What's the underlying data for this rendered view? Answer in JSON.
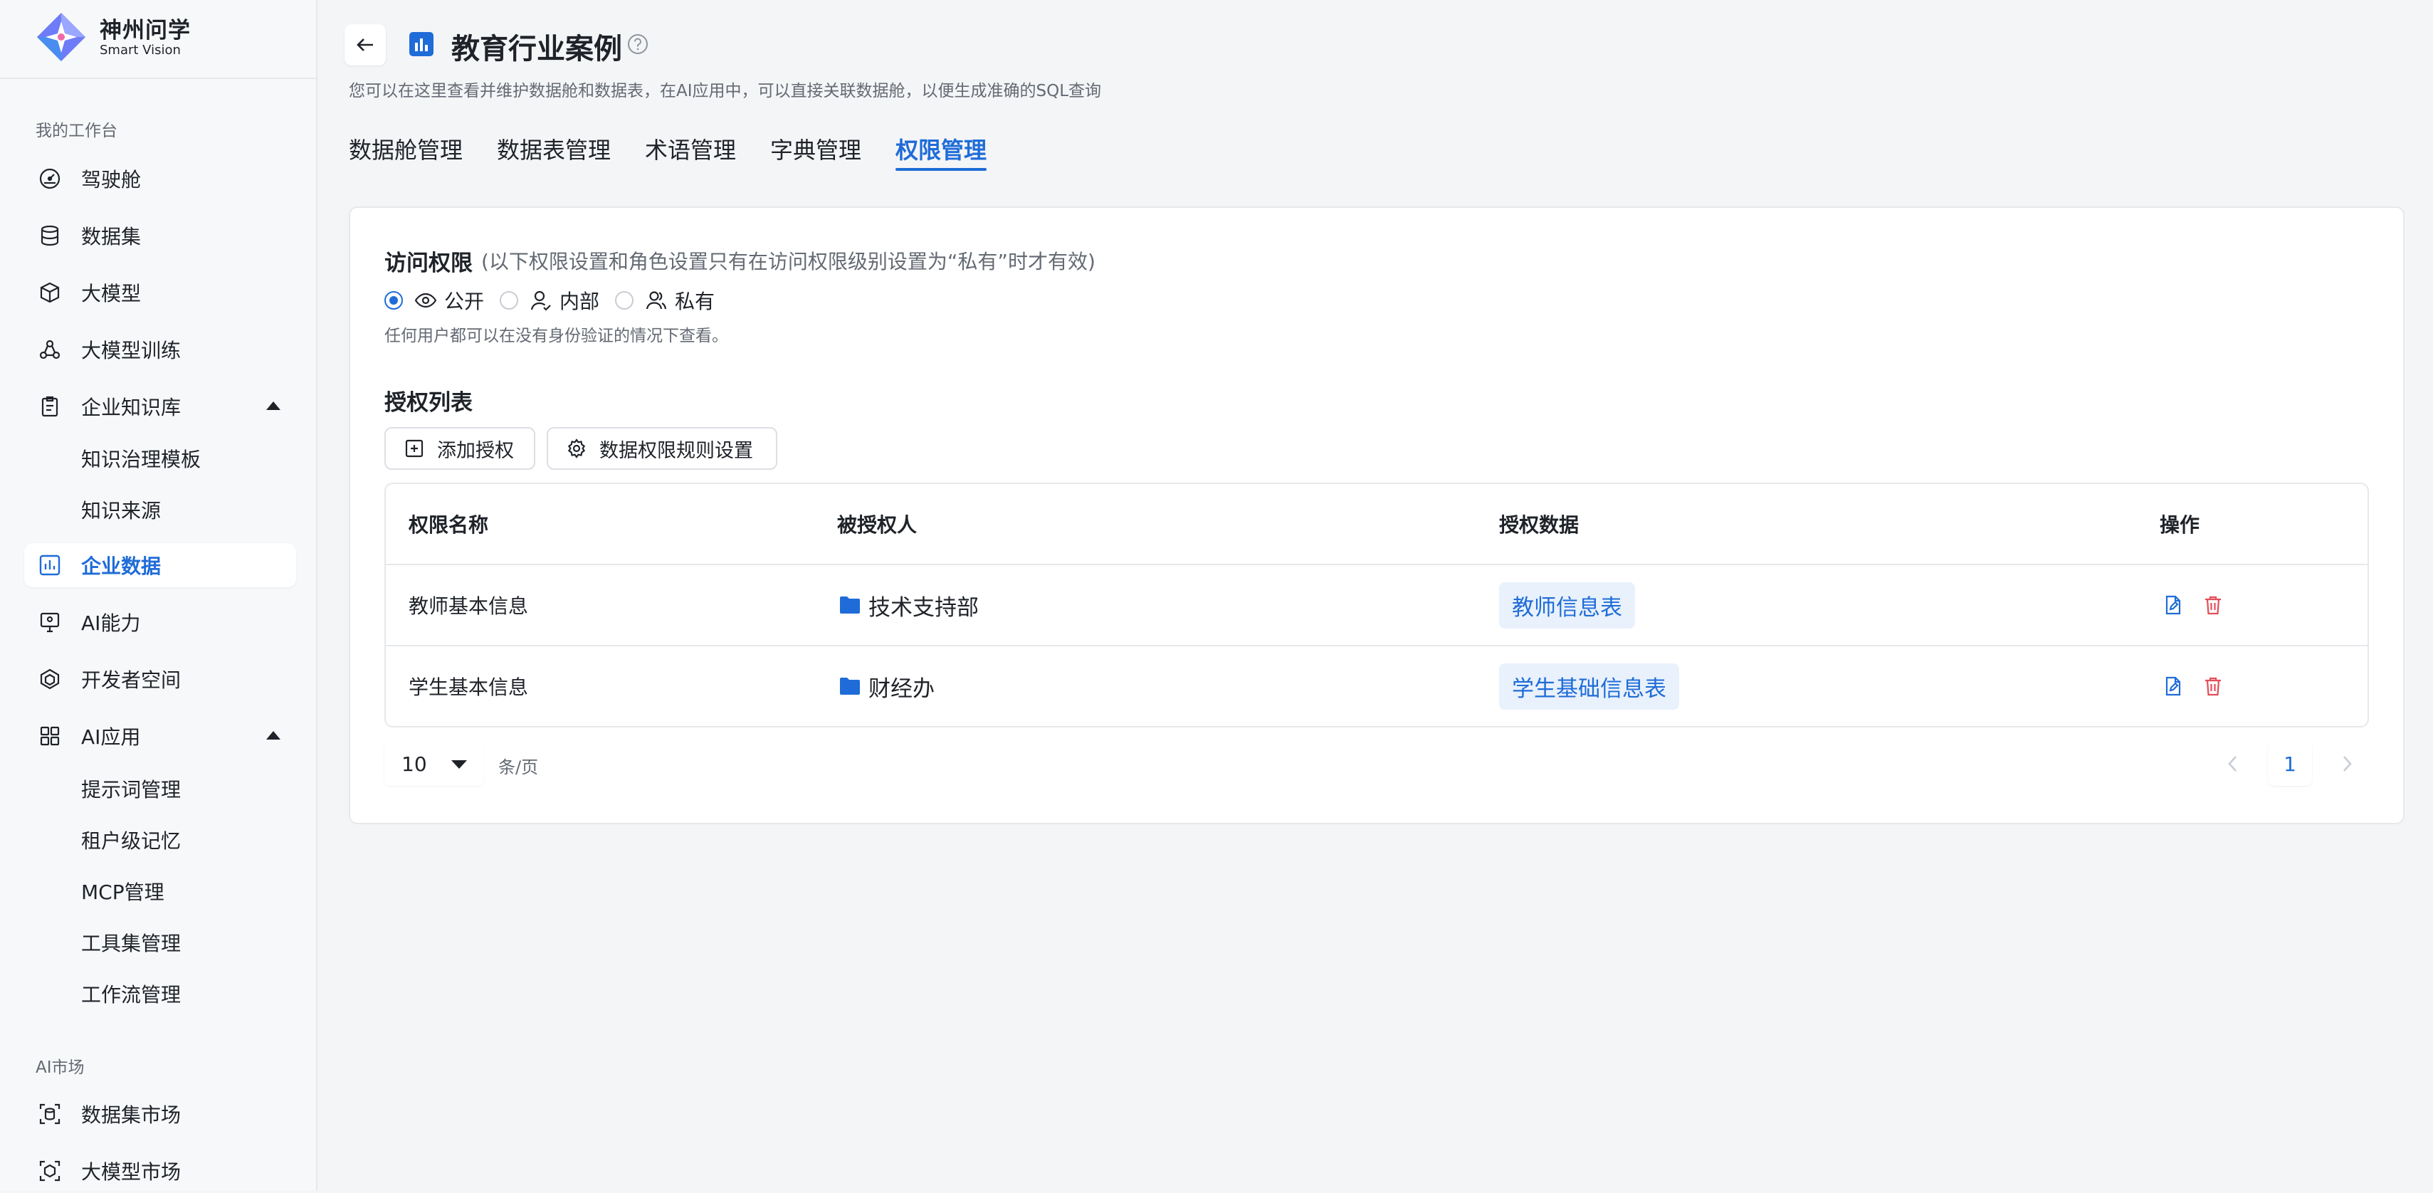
{
  "brand": {
    "name_cn": "神州问学",
    "name_en": "Smart Vision"
  },
  "sidebar": {
    "workbench_title": "我的工作台",
    "items": [
      {
        "label": "驾驶舱"
      },
      {
        "label": "数据集"
      },
      {
        "label": "大模型"
      },
      {
        "label": "大模型训练"
      },
      {
        "label": "企业知识库",
        "expanded": true,
        "children": [
          {
            "label": "知识治理模板"
          },
          {
            "label": "知识来源"
          }
        ]
      },
      {
        "label": "企业数据",
        "active": true
      },
      {
        "label": "AI能力"
      },
      {
        "label": "开发者空间"
      },
      {
        "label": "AI应用",
        "expanded": true,
        "children": [
          {
            "label": "提示词管理"
          },
          {
            "label": "租户级记忆"
          },
          {
            "label": "MCP管理"
          },
          {
            "label": "工具集管理"
          },
          {
            "label": "工作流管理"
          }
        ]
      }
    ],
    "market_title": "AI市场",
    "market_items": [
      {
        "label": "数据集市场"
      },
      {
        "label": "大模型市场"
      }
    ]
  },
  "header": {
    "title": "教育行业案例",
    "subtitle": "您可以在这里查看并维护数据舱和数据表，在AI应用中，可以直接关联数据舱，以便生成准确的SQL查询",
    "tabs": [
      {
        "label": "数据舱管理"
      },
      {
        "label": "数据表管理"
      },
      {
        "label": "术语管理"
      },
      {
        "label": "字典管理"
      },
      {
        "label": "权限管理",
        "active": true
      }
    ]
  },
  "access": {
    "title": "访问权限",
    "note": "(以下权限设置和角色设置只有在访问权限级别设置为“私有”时才有效)",
    "options": [
      {
        "label": "公开",
        "checked": true,
        "icon": "eye-icon"
      },
      {
        "label": "内部",
        "checked": false,
        "icon": "user-icon"
      },
      {
        "label": "私有",
        "checked": false,
        "icon": "users-icon"
      }
    ],
    "hint": "任何用户都可以在没有身份验证的情况下查看。"
  },
  "auth_list": {
    "title": "授权列表",
    "add_button": "添加授权",
    "rules_button": "数据权限规则设置",
    "columns": [
      "权限名称",
      "被授权人",
      "授权数据",
      "操作"
    ],
    "rows": [
      {
        "name": "教师基本信息",
        "grantee": "技术支持部",
        "data": "教师信息表"
      },
      {
        "name": "学生基本信息",
        "grantee": "财经办",
        "data": "学生基础信息表"
      }
    ]
  },
  "pagination": {
    "page_size": "10",
    "unit": "条/页",
    "current_page": "1"
  },
  "colors": {
    "accent": "#1f6cd8",
    "danger": "#e34d59",
    "tag_bg": "#e8f1fc"
  }
}
